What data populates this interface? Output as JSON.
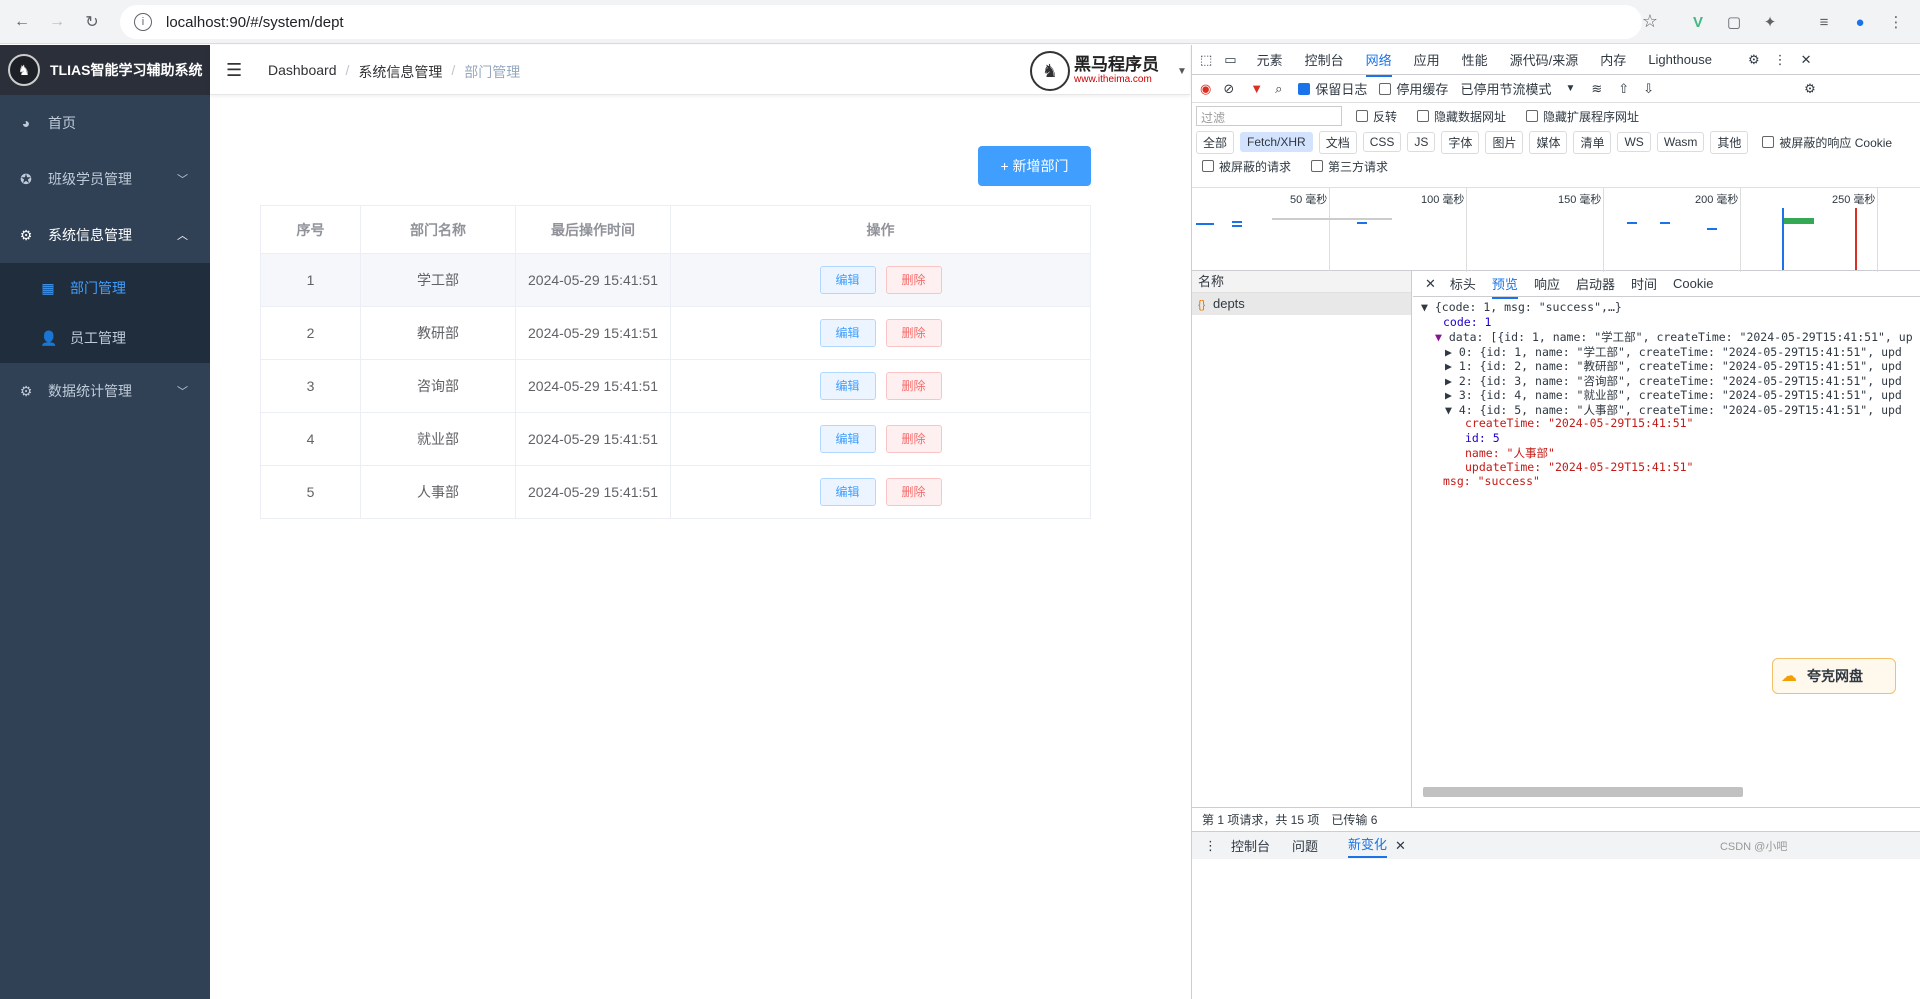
{
  "browser": {
    "url": "localhost:90/#/system/dept"
  },
  "sidebar": {
    "app_title": "TLIAS智能学习辅助系统",
    "items": [
      {
        "label": "首页",
        "icon": "dashboard-icon"
      },
      {
        "label": "班级学员管理",
        "icon": "gear-icon"
      },
      {
        "label": "系统信息管理",
        "icon": "gear-icon"
      },
      {
        "label": "部门管理",
        "icon": "grid-icon"
      },
      {
        "label": "员工管理",
        "icon": "user-icon"
      },
      {
        "label": "数据统计管理",
        "icon": "gear-icon"
      }
    ]
  },
  "header": {
    "breadcrumb": [
      "Dashboard",
      "系统信息管理",
      "部门管理"
    ],
    "brand_name": "黑马程序员",
    "brand_url": "www.itheima.com"
  },
  "main": {
    "add_button": "+ 新增部门",
    "columns": [
      "序号",
      "部门名称",
      "最后操作时间",
      "操作"
    ],
    "rows": [
      {
        "no": "1",
        "name": "学工部",
        "time": "2024-05-29 15:41:51"
      },
      {
        "no": "2",
        "name": "教研部",
        "time": "2024-05-29 15:41:51"
      },
      {
        "no": "3",
        "name": "咨询部",
        "time": "2024-05-29 15:41:51"
      },
      {
        "no": "4",
        "name": "就业部",
        "time": "2024-05-29 15:41:51"
      },
      {
        "no": "5",
        "name": "人事部",
        "time": "2024-05-29 15:41:51"
      }
    ],
    "edit_label": "编辑",
    "delete_label": "删除"
  },
  "devtools": {
    "tabs": [
      "元素",
      "控制台",
      "网络",
      "应用",
      "性能",
      "源代码/来源",
      "内存",
      "Lighthouse"
    ],
    "preserve_log": "保留日志",
    "disable_cache": "停用缓存",
    "throttle": "已停用节流模式",
    "filter_placeholder": "过滤",
    "invert": "反转",
    "hide_data_urls": "隐藏数据网址",
    "hide_ext_urls": "隐藏扩展程序网址",
    "type_filters": [
      "全部",
      "Fetch/XHR",
      "文档",
      "CSS",
      "JS",
      "字体",
      "图片",
      "媒体",
      "清单",
      "WS",
      "Wasm",
      "其他"
    ],
    "blocked_cookies": "被屏蔽的响应 Cookie",
    "blocked_requests": "被屏蔽的请求",
    "third_party": "第三方请求",
    "timeline_ticks": [
      "50 毫秒",
      "100 毫秒",
      "150 毫秒",
      "200 毫秒",
      "250 毫秒"
    ],
    "name_header": "名称",
    "request_name": "depts",
    "detail_tabs": [
      "标头",
      "预览",
      "响应",
      "启动器",
      "时间",
      "Cookie"
    ],
    "json_lines": [
      "{code: 1, msg: \"success\",…}",
      "code: 1",
      "data: [{id: 1, name: \"学工部\", createTime: \"2024-05-29T15:41:51\", up",
      "0: {id: 1, name: \"学工部\", createTime: \"2024-05-29T15:41:51\", upd",
      "1: {id: 2, name: \"教研部\", createTime: \"2024-05-29T15:41:51\", upd",
      "2: {id: 3, name: \"咨询部\", createTime: \"2024-05-29T15:41:51\", upd",
      "3: {id: 4, name: \"就业部\", createTime: \"2024-05-29T15:41:51\", upd",
      "4: {id: 5, name: \"人事部\", createTime: \"2024-05-29T15:41:51\", upd",
      "createTime: \"2024-05-29T15:41:51\"",
      "id: 5",
      "name: \"人事部\"",
      "updateTime: \"2024-05-29T15:41:51\"",
      "msg: \"success\""
    ],
    "status_requests": "第 1 项请求，共 15 项",
    "status_transferred": "已传输 6",
    "drawer_tabs": [
      "控制台",
      "问题",
      "新变化"
    ],
    "quark_label": "夸克网盘",
    "watermark": "CSDN @小吧"
  }
}
